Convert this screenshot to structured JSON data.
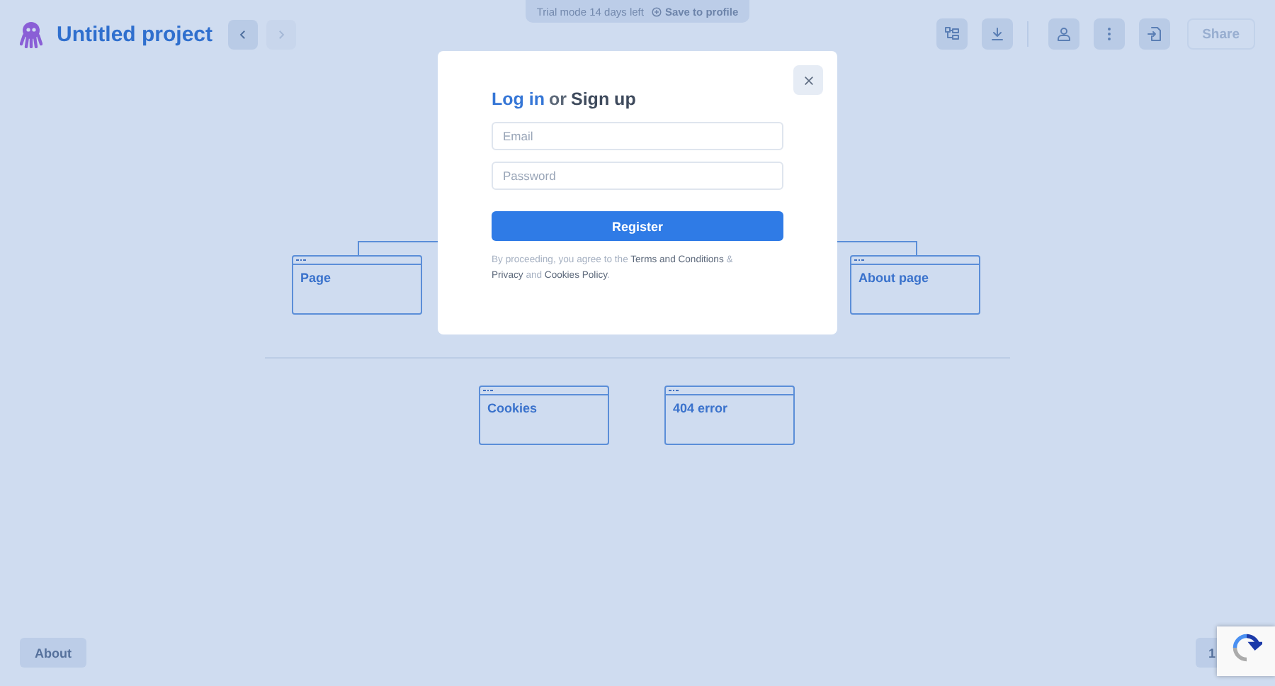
{
  "header": {
    "project_title": "Untitled project",
    "nav": [
      {
        "kind": "back",
        "disabled": false
      },
      {
        "kind": "forward",
        "disabled": true
      }
    ],
    "tools": [
      {
        "kind": "sitemap"
      },
      {
        "kind": "download"
      },
      {
        "kind": "user"
      },
      {
        "kind": "more"
      },
      {
        "kind": "export"
      }
    ],
    "share": {
      "label": "Share",
      "disabled": true
    }
  },
  "trial_banner": {
    "text": "Trial mode 14 days left",
    "action": "Save to profile"
  },
  "sitemap": {
    "nodes": [
      {
        "label": "Page"
      },
      {
        "label": "About page"
      },
      {
        "label": "Cookies"
      },
      {
        "label": "404 error"
      }
    ]
  },
  "dialog": {
    "title_login": "Log in",
    "title_or": "or",
    "title_signup": "Sign up",
    "fields": [
      {
        "placeholder": "Email"
      },
      {
        "placeholder": "Password"
      }
    ],
    "submit": "Register",
    "legal": [
      {
        "kind": "plain",
        "text": "By proceeding, you agree to the"
      },
      {
        "kind": "link",
        "text": "Terms and Conditions"
      },
      {
        "kind": "plain",
        "text": "&"
      },
      {
        "kind": "link",
        "text": "Privacy"
      },
      {
        "kind": "plain",
        "text": "and"
      },
      {
        "kind": "link",
        "text": "Cookies Policy"
      },
      {
        "kind": "plain",
        "text": "."
      }
    ]
  },
  "footer": {
    "about": "About",
    "zoom": "1"
  }
}
